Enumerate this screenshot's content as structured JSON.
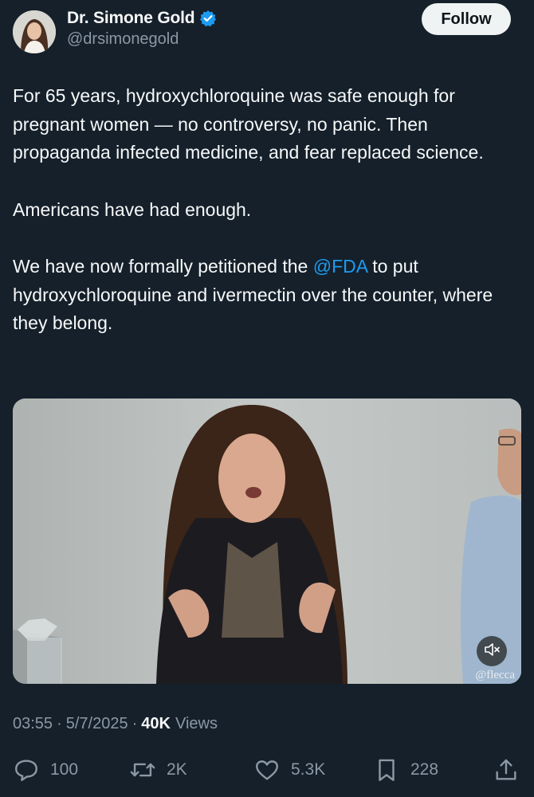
{
  "author": {
    "display_name": "Dr. Simone Gold",
    "handle": "@drsimonegold",
    "verified": true
  },
  "follow_label": "Follow",
  "tweet": {
    "paragraph_1": "For 65 years, hydroxychloroquine was safe enough for pregnant women — no controversy, no panic. Then propaganda infected medicine, and fear replaced science.",
    "paragraph_2": "Americans have had enough.",
    "paragraph_3_before": "We have now formally petitioned the ",
    "paragraph_3_mention": "@FDA",
    "paragraph_3_after": " to put hydroxychloroquine and ivermectin over the counter, where they belong."
  },
  "media": {
    "watermark": "@flecca",
    "mute_icon": "speaker-muted-icon"
  },
  "meta": {
    "time": "03:55",
    "date": "5/7/2025",
    "views_count": "40K",
    "views_label": "Views"
  },
  "actions": {
    "replies": "100",
    "reposts": "2K",
    "likes": "5.3K",
    "bookmarks": "228"
  },
  "colors": {
    "background": "#15202b",
    "text": "#f7f9f9",
    "secondary_text": "#8b98a5",
    "accent": "#1d9bf0",
    "follow_button_bg": "#eff3f4"
  }
}
